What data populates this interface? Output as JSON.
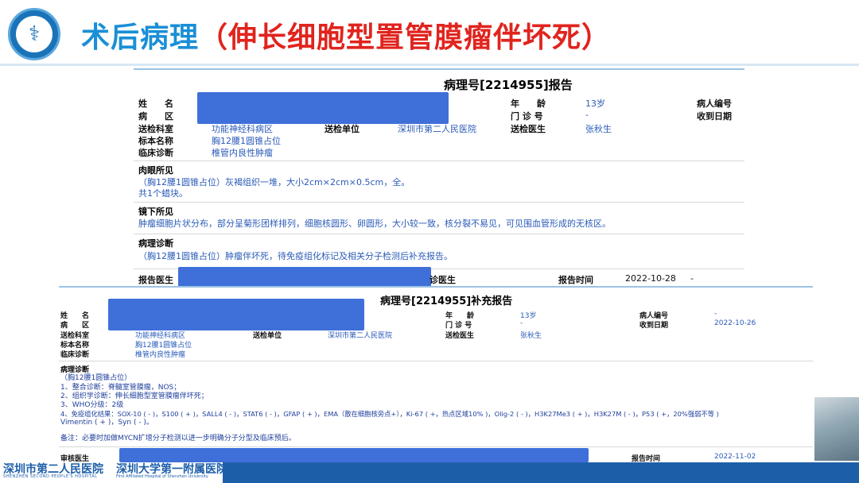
{
  "header": {
    "title": "术后病理",
    "subtitle": "（伸长细胞型置管膜瘤伴坏死）",
    "accent_color": "#1a8fd6",
    "subtitle_color": "#e0241e"
  },
  "report1": {
    "title": "病理号[2214955]报告",
    "labels": {
      "name": "姓　　名",
      "ward": "病　　区",
      "dept": "送检科室",
      "specimen": "标本名称",
      "diagnosis": "临床诊断",
      "age": "年　　龄",
      "clinic_no": "门 诊 号",
      "unit": "送检单位",
      "doctor": "送检医生",
      "patient_no": "病人编号",
      "received": "收到日期",
      "reporter": "报告医生",
      "reviewer_tail": "诊医生",
      "report_time": "报告时间"
    },
    "values": {
      "age": "13岁",
      "clinic_no": "-",
      "dept": "功能神经科病区",
      "unit": "深圳市第二人民医院",
      "doctor": "张秋生",
      "specimen": "胸12腰1圆锥占位",
      "diagnosis": "椎管内良性肿瘤",
      "report_time": "2022-10-28",
      "report_time_dash": "-"
    },
    "gross": {
      "heading": "肉眼所见",
      "line1": "（胸12腰1圆锥占位）灰褐组织一堆，大小2cm×2cm×0.5cm，全。",
      "line2": "共1个蜡块。"
    },
    "micro": {
      "heading": "镜下所见",
      "line1": "肿瘤细胞片状分布，部分呈菊形团样排列，细胞核圆形、卵圆形，大小较一致，核分裂不易见，可见围血管形成的无核区。"
    },
    "path": {
      "heading": "病理诊断",
      "line1": "（胸12腰1圆锥占位）肿瘤伴坏死，待免疫组化标记及相关分子检测后补充报告。"
    }
  },
  "report2": {
    "title": "病理号[2214955]补充报告",
    "labels": {
      "name": "姓　　名",
      "ward": "病　　区",
      "dept": "送检科室",
      "specimen": "标本名称",
      "diagnosis": "临床诊断",
      "age": "年　　龄",
      "clinic_no": "门 诊 号",
      "unit": "送检单位",
      "doctor": "送检医生",
      "patient_no": "病人编号",
      "received": "收到日期",
      "reviewer": "审核医生",
      "report_time": "报告时间"
    },
    "values": {
      "age": "13岁",
      "clinic_no": "-",
      "dept": "功能神经科病区",
      "unit": "深圳市第二人民医院",
      "doctor": "张秋生",
      "specimen": "胸12腰1圆锥占位",
      "diagnosis": "椎管内良性肿瘤",
      "patient_no": "-",
      "received": "2022-10-26",
      "report_time": "2022-11-02"
    },
    "path": {
      "heading": "病理诊断",
      "lines": [
        "（胸12腰1圆锥占位）",
        "1、整合诊断：脊髓室管膜瘤，NOS；",
        "2、组织学诊断：伸长细胞型室管膜瘤伴坏死；",
        "3、WHO分级：2级",
        "4、免疫组化结果：SOX-10 ( - )，S100 ( + )，SALL4 ( - )，STAT6 ( - )，GFAP ( + )，EMA（散在细胞核旁点+），Ki-67 ( +，热点区域10% )，Olig-2 ( - )，H3K27Me3 ( + )，H3K27M ( - )，P53 ( +，20%强弱不等 )",
        "Vimentin ( + )，Syn ( - )。"
      ],
      "note": "备注：必要时加做MYCN扩增分子检测以进一步明确分子分型及临床预后。"
    }
  },
  "footer": {
    "hospital1": "深圳市第二人民医院",
    "hospital1_en": "SHENZHEN SECOND PEOPLE'S HOSPITAL",
    "hospital2": "深圳大学第一附属医院",
    "hospital2_en": "First Affiliated Hospital of Shenzhen University",
    "bar_color": "#1d5ea9"
  },
  "icons": {
    "logo": "hospital-logo-icon",
    "logo_glyph": "⚕"
  }
}
